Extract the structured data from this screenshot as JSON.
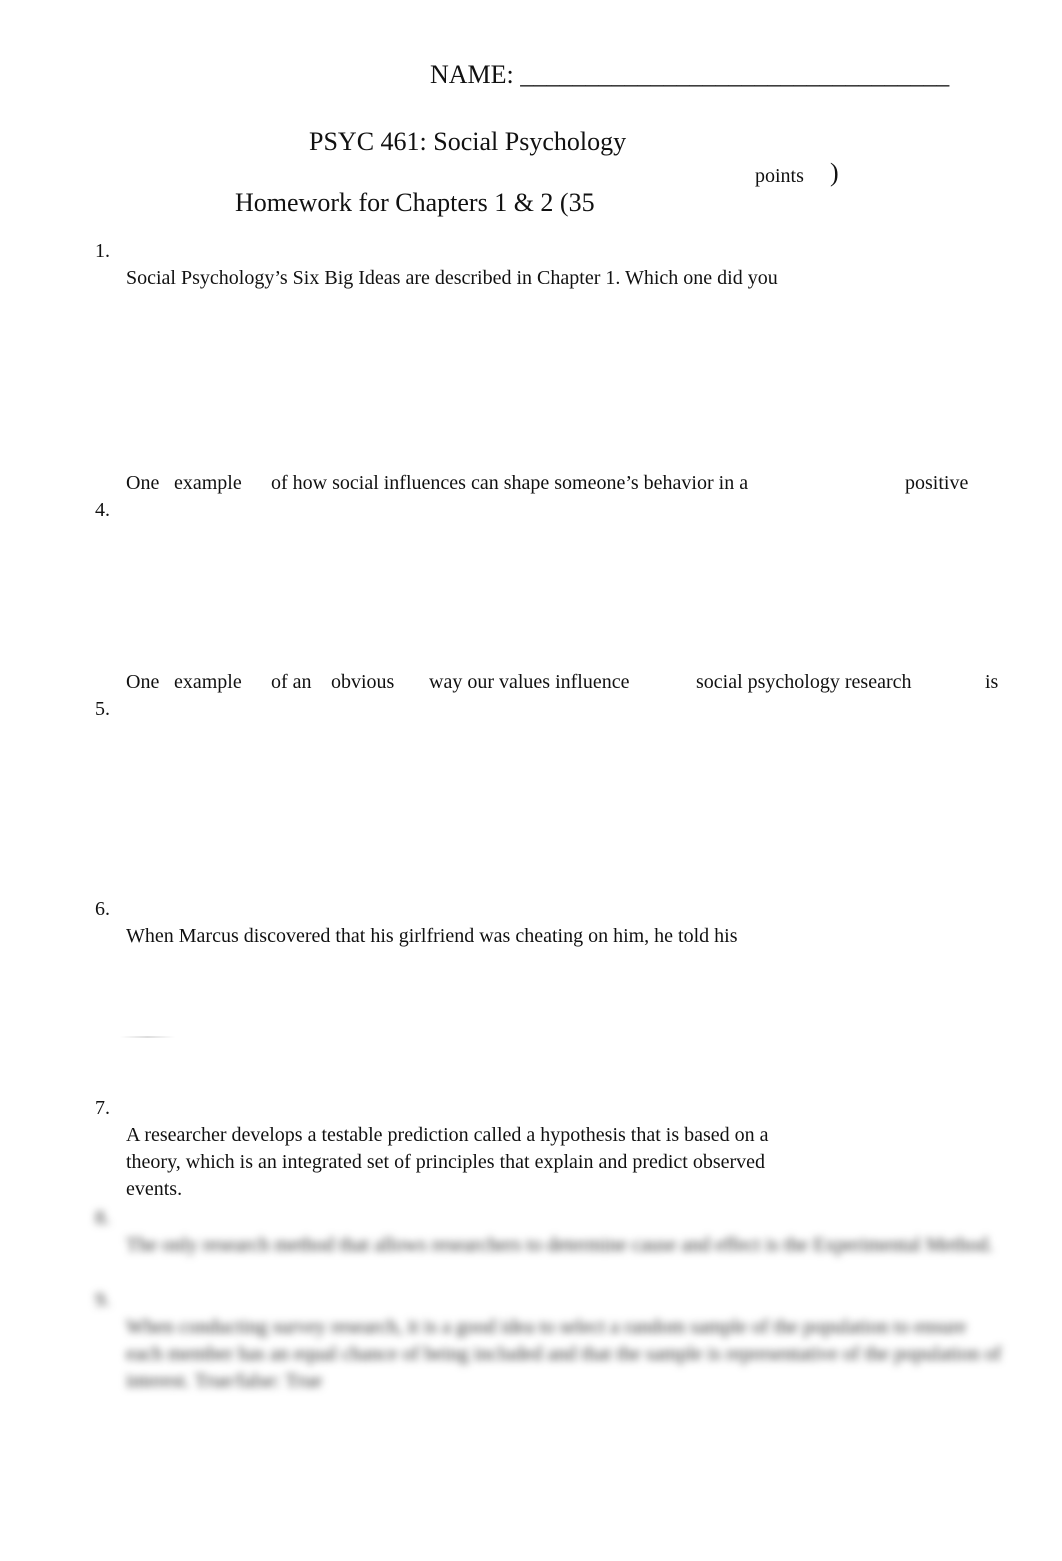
{
  "header": {
    "name_label": "NAME: _________________________________",
    "course_title": "PSYC 461: Social Psychology",
    "homework_title": "Homework for Chapters 1 & 2 (35",
    "points_label": "points",
    "closing_paren": ")"
  },
  "questions": [
    {
      "number": "1.",
      "text": "Social Psychology’s Six Big Ideas are described in Chapter 1. Which one did you"
    },
    {
      "number": "4.",
      "segments": [
        "One",
        "example",
        "of how social influences can shape someone’s behavior in a",
        "positive"
      ]
    },
    {
      "number": "5.",
      "segments": [
        "One",
        "example",
        "of an",
        "obvious",
        "way our values influence",
        "social psychology research",
        "is"
      ]
    },
    {
      "number": "6.",
      "text": "When Marcus discovered that his girlfriend was cheating on him, he told his"
    },
    {
      "number": "7.",
      "text": "A researcher develops a testable prediction called a hypothesis that is based on a theory, which is an integrated set of principles that explain and predict observed events."
    }
  ],
  "blurred_questions": [
    {
      "number": "8.",
      "text": "The only research method that allows researchers to determine cause and effect is the Experimental Method."
    },
    {
      "number": "9.",
      "text": "When conducting survey research, it is a good idea to select a random sample of the population to ensure each member has an equal chance of being included and that the sample is representative of the population of interest.     True/false: True"
    }
  ]
}
